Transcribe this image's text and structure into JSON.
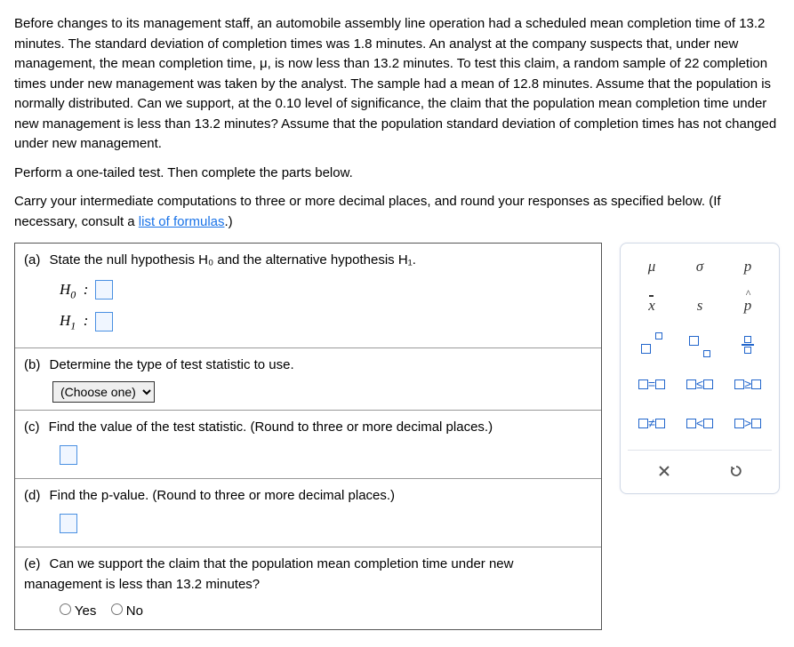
{
  "intro": {
    "p1": "Before changes to its management staff, an automobile assembly line operation had a scheduled mean completion time of 13.2 minutes. The standard deviation of completion times was 1.8 minutes. An analyst at the company suspects that, under new management, the mean completion time, μ, is now less than 13.2 minutes. To test this claim, a random sample of 22 completion times under new management was taken by the analyst. The sample had a mean of 12.8 minutes. Assume that the population is normally distributed. Can we support, at the 0.10 level of significance, the claim that the population mean completion time under new management is less than 13.2 minutes? Assume that the population standard deviation of completion times has not changed under new management.",
    "p2": "Perform a one-tailed test. Then complete the parts below.",
    "p3_a": "Carry your intermediate computations to three or more decimal places, and round your responses as specified below. (If necessary, consult a ",
    "link": "list of formulas",
    "p3_b": ".)"
  },
  "parts": {
    "a": {
      "label": "(a)",
      "text": "State the null hypothesis H₀ and the alternative hypothesis H₁.",
      "h0": "H₀  :",
      "h1": "H₁  :"
    },
    "b": {
      "label": "(b)",
      "text": "Determine the type of test statistic to use.",
      "select": "(Choose one)"
    },
    "c": {
      "label": "(c)",
      "text": "Find the value of the test statistic. (Round to three or more decimal places.)"
    },
    "d": {
      "label": "(d)",
      "text": "Find the p-value. (Round to three or more decimal places.)"
    },
    "e": {
      "label": "(e)",
      "text": "Can we support the claim that the population mean completion time under new management is less than 13.2 minutes?",
      "yes": "Yes",
      "no": "No"
    }
  },
  "palette": {
    "r1": [
      "μ",
      "σ",
      "p"
    ],
    "r2": [
      "x̄",
      "s",
      "p̂"
    ],
    "rel": {
      "eq": "=",
      "le": "≤",
      "ge": "≥",
      "ne": "≠",
      "lt": "<",
      "gt": ">"
    }
  }
}
